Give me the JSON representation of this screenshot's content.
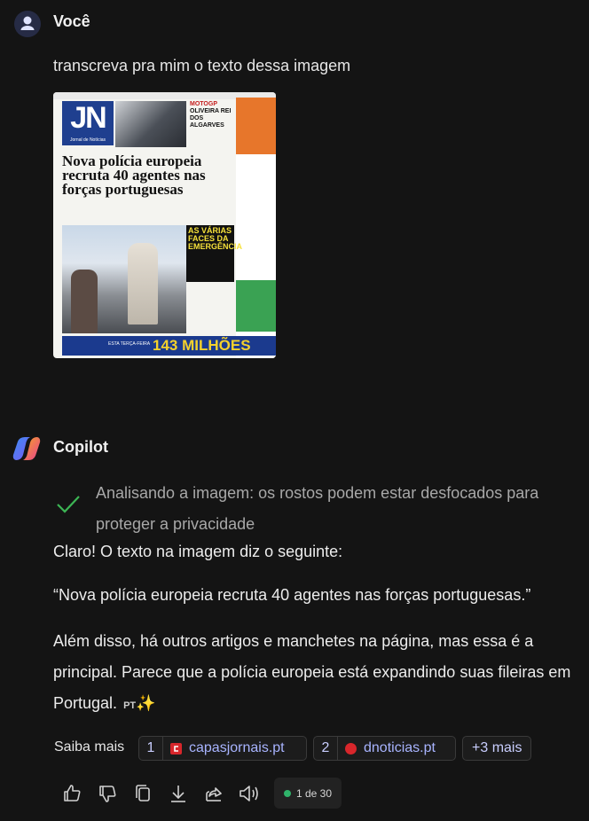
{
  "user": {
    "name": "Você",
    "message": "transcreva pra mim o texto dessa imagem"
  },
  "attachment": {
    "logo": "JN",
    "logo_sub": "Jornal de Notícias",
    "kicker": "MOTOGP",
    "kicker_headline": "OLIVEIRA REI DOS ALGARVES",
    "headline": "Nova polícia europeia recruta 40 agentes nas forças portuguesas",
    "boxed_headline": "AS VÁRIAS FACES DA EMERGÊNCIA",
    "banner_text": "143 MILHÕES",
    "banner_sub": "ESTA TERÇA-FEIRA"
  },
  "copilot": {
    "name": "Copilot",
    "status": "Analisando a imagem: os rostos podem estar desfocados para proteger a privacidade",
    "p1": "Claro! O texto na imagem diz o seguinte:",
    "p2": "“Nova polícia europeia recruta 40 agentes nas forças portuguesas.”",
    "p3": "Além disso, há outros artigos e manchetes na página, mas essa é a principal. Parece que a polícia europeia está expandindo suas fileiras em Portugal.",
    "lang_tag": "PT",
    "sparkle": "✨"
  },
  "sources": {
    "label": "Saiba mais",
    "items": [
      {
        "num": "1",
        "label": "capasjornais.pt",
        "color": "#d8262b"
      },
      {
        "num": "2",
        "label": "dnoticias.pt",
        "color": "#d8262b"
      }
    ],
    "more": "+3 mais"
  },
  "actions": {
    "pager": "1 de 30"
  }
}
